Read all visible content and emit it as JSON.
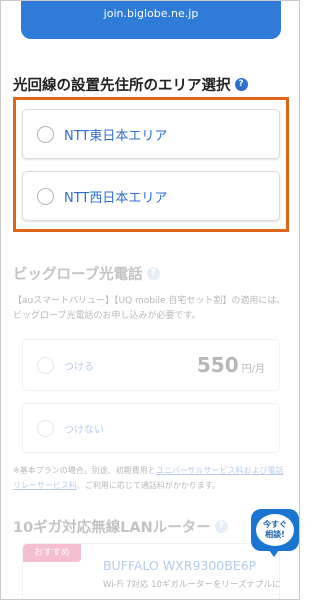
{
  "browser": {
    "url": "join.biglobe.ne.jp"
  },
  "area_section": {
    "title": "光回線の設置先住所のエリア選択",
    "help_icon": "?",
    "options": [
      {
        "label": "NTT東日本エリア"
      },
      {
        "label": "NTT西日本エリア"
      }
    ]
  },
  "phone_section": {
    "title": "ビッグローブ光電話",
    "help_icon": "?",
    "note": "【auスマートバリュー】【UQ mobile 自宅セット割】の適用には、ビッグローブ光電話のお申し込みが必要です。",
    "options": [
      {
        "label": "つける",
        "price": "550",
        "unit": "円/月"
      },
      {
        "label": "つけない"
      }
    ],
    "fee_note_prefix": "※基本プランの場合。別途、初期費用と",
    "fee_note_link": "ユニバーサルサービス料および電話リレーサービス料",
    "fee_note_suffix": "、ご利用に応じて通話料がかかります。"
  },
  "lan_section": {
    "title": "10ギガ対応無線LANルーター",
    "help_icon": "?",
    "badge": "おすすめ",
    "product_name": "BUFFALO WXR9300BE6P",
    "product_sub": "Wi-Fi 7対応 10ギガルーターをリーズナブルに"
  },
  "chat": {
    "line1": "今すぐ",
    "line2": "相談!"
  }
}
